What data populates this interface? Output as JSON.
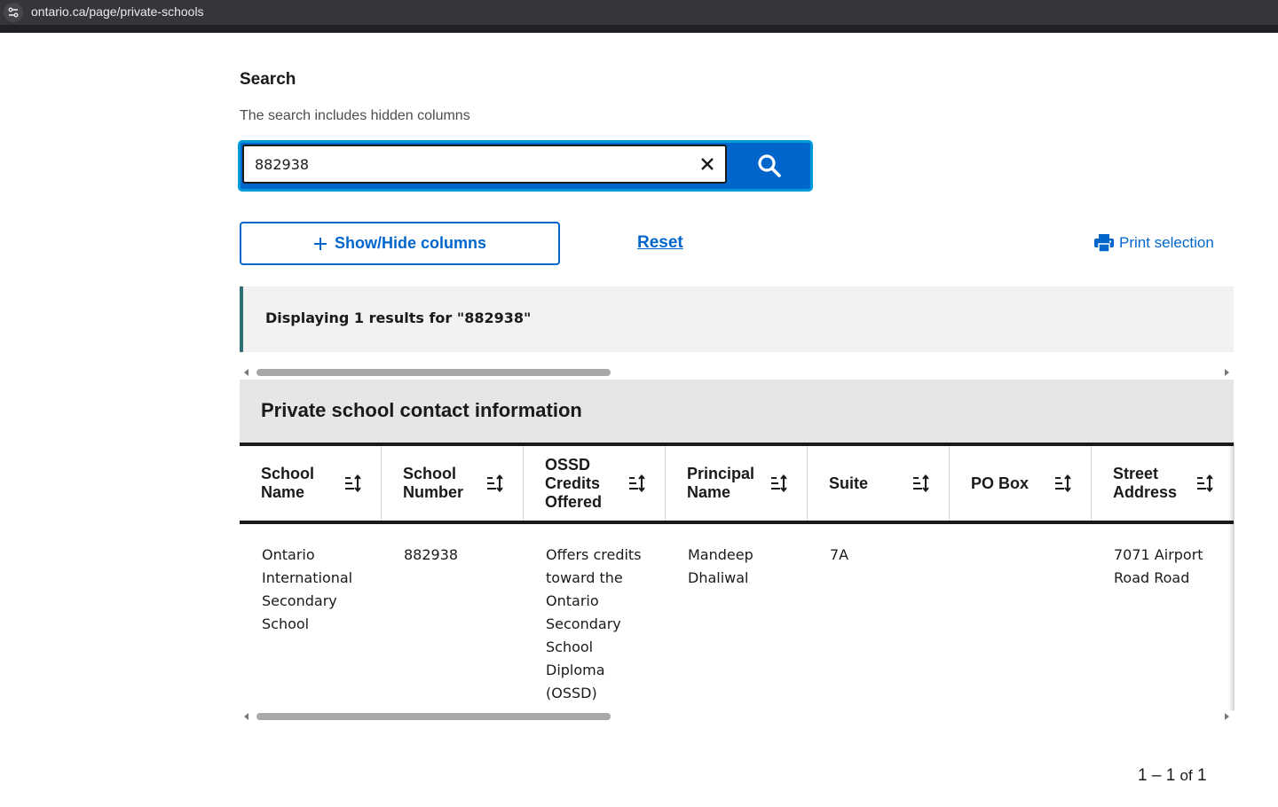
{
  "browser": {
    "url": "ontario.ca/page/private-schools"
  },
  "search": {
    "heading": "Search",
    "hint": "The search includes hidden columns",
    "value": "882938"
  },
  "controls": {
    "show_hide_label": "Show/Hide columns",
    "reset_label": "Reset",
    "print_label": "Print selection"
  },
  "results": {
    "message": "Displaying 1 results for \"882938\""
  },
  "table": {
    "caption": "Private school contact information",
    "columns": [
      {
        "label": "School Name"
      },
      {
        "label": "School Number"
      },
      {
        "label": "OSSD Credits Offered"
      },
      {
        "label": "Principal Name"
      },
      {
        "label": "Suite"
      },
      {
        "label": "PO Box"
      },
      {
        "label": "Street Address"
      }
    ],
    "rows": [
      [
        "Ontario International Secondary School",
        "882938",
        "Offers credits toward the Ontario Secondary School Diploma (OSSD)",
        "Mandeep Dhaliwal",
        "7A",
        "",
        "7071 Airport Road Road"
      ]
    ]
  },
  "pagination": {
    "range": "1 – 1",
    "of": "of",
    "total": "1"
  },
  "colors": {
    "primary": "#0066cc",
    "focus": "#009adb",
    "callout_border": "#2f6f6f"
  },
  "icons": [
    "settings-sliders-icon",
    "close-icon",
    "search-icon",
    "plus-icon",
    "printer-icon",
    "sort-icon"
  ]
}
